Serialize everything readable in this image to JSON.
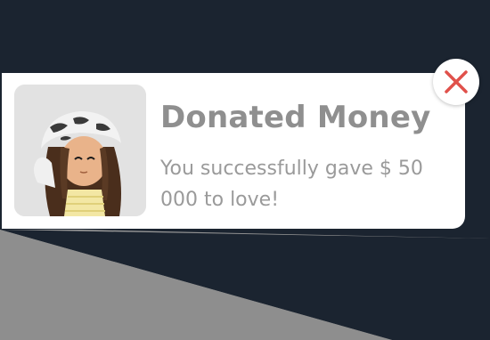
{
  "notification": {
    "title": "Donated Money",
    "message": "You successfully gave $ 50 000 to love!",
    "avatar_icon": "roblox-avatar-thumbnail",
    "close_icon": "close-x-icon"
  },
  "colors": {
    "background": "#1b2430",
    "card": "#ffffff",
    "title_text": "#8f8f8f",
    "body_text": "#9a9a9a",
    "close_x": "#e0514b",
    "avatar_bg": "#e2e2e2"
  }
}
